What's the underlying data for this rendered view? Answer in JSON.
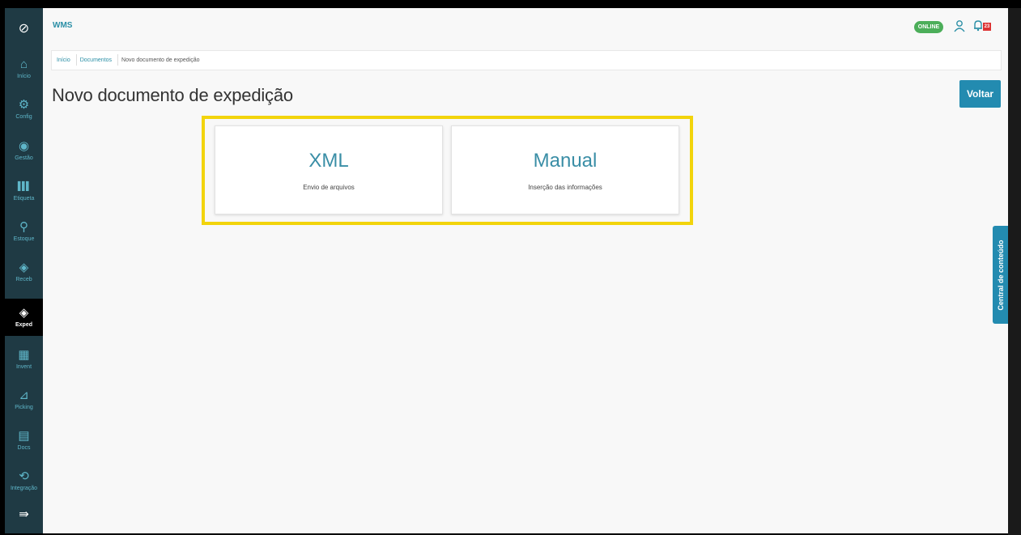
{
  "app": {
    "title": "WMS"
  },
  "status": {
    "online_label": "ONLINE",
    "notification_count": "23"
  },
  "sidebar": {
    "items": [
      {
        "label": "Início",
        "icon": "home-icon",
        "glyph": "⌂",
        "active": false
      },
      {
        "label": "Config",
        "icon": "gear-icon",
        "glyph": "⚙",
        "active": false
      },
      {
        "label": "Gestão",
        "icon": "location-pin-icon",
        "glyph": "◉",
        "active": false
      },
      {
        "label": "Etiqueta",
        "icon": "barcode-icon",
        "glyph": "▌▌▌",
        "active": false
      },
      {
        "label": "Estoque",
        "icon": "search-icon",
        "glyph": "⚲",
        "active": false
      },
      {
        "label": "Receb",
        "icon": "box-icon",
        "glyph": "◈",
        "active": false
      },
      {
        "label": "Exped",
        "icon": "box-icon",
        "glyph": "◈",
        "active": true
      },
      {
        "label": "Invent",
        "icon": "building-icon",
        "glyph": "▦",
        "active": false
      },
      {
        "label": "Picking",
        "icon": "hand-truck-icon",
        "glyph": "⊿",
        "active": false
      },
      {
        "label": "Docs",
        "icon": "document-icon",
        "glyph": "▤",
        "active": false
      },
      {
        "label": "Integração",
        "icon": "sync-icon",
        "glyph": "⟲",
        "active": false
      }
    ],
    "collapse_icon": "menu-collapse-icon",
    "collapse_glyph": "⇛",
    "logo_glyph": "⊘"
  },
  "breadcrumb": {
    "items": [
      "Início",
      "Documentos",
      "Novo documento de expedição"
    ]
  },
  "page": {
    "title": "Novo documento de expedição",
    "back_label": "Voltar"
  },
  "cards": [
    {
      "title": "XML",
      "subtitle": "Envio de arquivos"
    },
    {
      "title": "Manual",
      "subtitle": "Inserção das informações"
    }
  ],
  "side_tab": {
    "label": "Central de conteúdo"
  },
  "colors": {
    "sidebar": "#1f3a44",
    "accent": "#238bb0",
    "highlight": "#f2d40c",
    "online": "#4cae5a"
  }
}
